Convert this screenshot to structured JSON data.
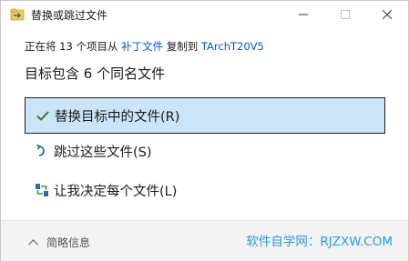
{
  "window": {
    "title": "替换或跳过文件"
  },
  "progress": {
    "prefix": "正在将 13 个项目从 ",
    "source": "补丁文件",
    "middle": " 复制到 ",
    "destination": "TArchT20V5"
  },
  "heading": "目标包含 6 个同名文件",
  "options": [
    {
      "label": "替换目标中的文件(R)",
      "icon": "checkmark-icon",
      "selected": true
    },
    {
      "label": "跳过这些文件(S)",
      "icon": "skip-arrow-icon",
      "selected": false
    },
    {
      "label": "让我决定每个文件(L)",
      "icon": "decide-each-icon",
      "selected": false
    }
  ],
  "footer": {
    "details_label": "简略信息",
    "watermark": "软件自学网：RJZXW.COM"
  },
  "colors": {
    "selected_bg": "#cce4f7",
    "link": "#0b57d0",
    "check": "#2e7d32",
    "watermark": "#2a9ae8"
  }
}
